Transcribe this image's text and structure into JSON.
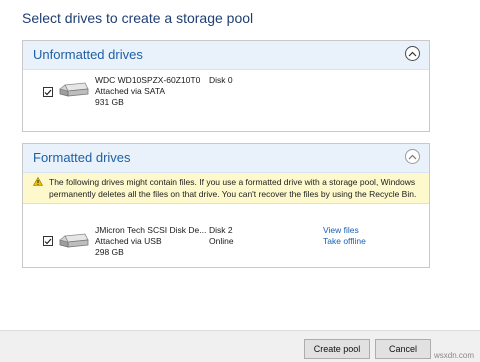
{
  "page": {
    "title": "Select drives to create a storage pool"
  },
  "unformatted": {
    "title": "Unformatted drives",
    "drives": [
      {
        "name": "WDC WD10SPZX-60Z10T0",
        "connection": "Attached via SATA",
        "size": "931 GB",
        "disk": "Disk 0",
        "status": "",
        "checked": true
      }
    ]
  },
  "formatted": {
    "title": "Formatted drives",
    "warning": "The following drives might contain files. If you use a formatted drive with a storage pool, Windows permanently deletes all the files on that drive. You can't recover the files by using the Recycle Bin.",
    "drives": [
      {
        "name": "JMicron Tech SCSI Disk De...",
        "connection": "Attached via USB",
        "size": "298 GB",
        "disk": "Disk 2",
        "status": "Online",
        "view_files": "View files",
        "take_offline": "Take offline",
        "checked": true
      }
    ]
  },
  "footer": {
    "create_label": "Create pool",
    "cancel_label": "Cancel"
  },
  "watermark": "wsxdn.com",
  "colors": {
    "title": "#1f3f73",
    "section_title": "#1f5fa6",
    "link": "#1a5fb4",
    "warning_bg": "#fdf9cc",
    "header_bg": "#e9f1fb"
  }
}
